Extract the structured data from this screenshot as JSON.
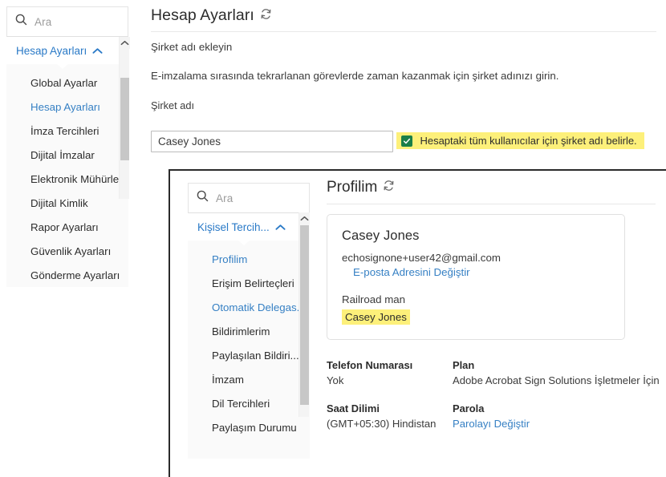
{
  "outer": {
    "search": {
      "placeholder": "Ara",
      "icon": "search-icon"
    },
    "group_header": {
      "label": "Hesap Ayarları",
      "chevron": "chevron-up-icon"
    },
    "menu_items": [
      {
        "label": "Global Ayarlar",
        "active": false
      },
      {
        "label": "Hesap Ayarları",
        "active": true
      },
      {
        "label": "İmza Tercihleri",
        "active": false
      },
      {
        "label": "Dijital İmzalar",
        "active": false
      },
      {
        "label": "Elektronik Mühürler",
        "active": false
      },
      {
        "label": "Dijital Kimlik",
        "active": false
      },
      {
        "label": "Rapor Ayarları",
        "active": false
      },
      {
        "label": "Güvenlik Ayarları",
        "active": false
      },
      {
        "label": "Gönderme Ayarları",
        "active": false
      }
    ],
    "page_title": "Hesap Ayarları",
    "refresh_icon": "refresh-icon",
    "section_subtitle": "Şirket adı ekleyin",
    "section_description": "E-imzalama sırasında tekrarlanan görevlerde zaman kazanmak için şirket adınızı girin.",
    "field_label": "Şirket adı",
    "field_value": "Casey Jones",
    "checkbox": {
      "checked": true,
      "label": "Hesaptaki tüm kullanıcılar için şirket adı belirle.",
      "highlight_color": "#fdf07a"
    }
  },
  "inner": {
    "search": {
      "placeholder": "Ara",
      "icon": "search-icon"
    },
    "group_header": {
      "label": "Kişisel Tercih...",
      "chevron": "chevron-up-icon"
    },
    "menu_items": [
      {
        "label": "Profilim",
        "active": true
      },
      {
        "label": "Erişim Belirteçleri",
        "active": false
      },
      {
        "label": "Otomatik Delegas...",
        "active": true
      },
      {
        "label": "Bildirimlerim",
        "active": false
      },
      {
        "label": "Paylaşılan Bildiri...",
        "active": false
      },
      {
        "label": "İmzam",
        "active": false
      },
      {
        "label": "Dil Tercihleri",
        "active": false
      },
      {
        "label": "Paylaşım Durumu",
        "active": false
      }
    ],
    "page_title": "Profilim",
    "refresh_icon": "refresh-icon",
    "profile_card": {
      "name": "Casey Jones",
      "email": "echosignone+user42@gmail.com",
      "change_email_link": "E-posta Adresini Değiştir",
      "job_title": "Railroad man",
      "company": "Casey Jones",
      "company_highlight_color": "#fdf07a"
    },
    "info": [
      {
        "label": "Telefon Numarası",
        "value": "Yok",
        "is_link": false
      },
      {
        "label": "Plan",
        "value": "Adobe Acrobat Sign Solutions İşletmeler İçin",
        "is_link": false
      },
      {
        "label": "Saat Dilimi",
        "value": "(GMT+05:30) Hindistan",
        "is_link": false
      },
      {
        "label": "Parola",
        "value": "Parolayı Değiştir",
        "is_link": true
      }
    ]
  },
  "colors": {
    "link": "#3680c4",
    "checkbox_green": "#1a7f48",
    "highlight": "#fdf07a",
    "text": "#2c2c2c"
  }
}
